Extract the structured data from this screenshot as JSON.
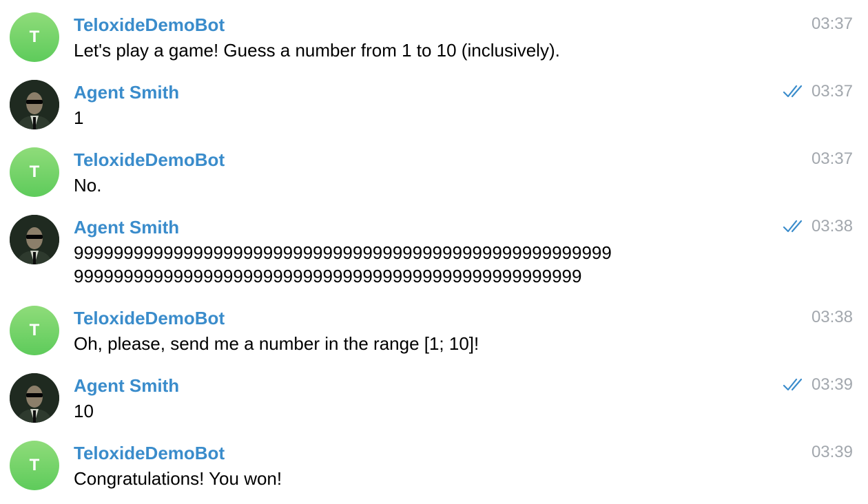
{
  "messages": [
    {
      "sender": "TeloxideDemoBot",
      "avatar_letter": "T",
      "lines": [
        "Let's play a game! Guess a number from 1 to 10 (inclusively)."
      ],
      "time": "03:37",
      "read": false
    },
    {
      "sender": "Agent Smith",
      "lines": [
        "1"
      ],
      "time": "03:37",
      "read": true
    },
    {
      "sender": "TeloxideDemoBot",
      "avatar_letter": "T",
      "lines": [
        "No."
      ],
      "time": "03:37",
      "read": false
    },
    {
      "sender": "Agent Smith",
      "lines": [
        "999999999999999999999999999999999999999999999999999999",
        "999999999999999999999999999999999999999999999999999"
      ],
      "time": "03:38",
      "read": true
    },
    {
      "sender": "TeloxideDemoBot",
      "avatar_letter": "T",
      "lines": [
        "Oh, please, send me a number in the range [1; 10]!"
      ],
      "time": "03:38",
      "read": false
    },
    {
      "sender": "Agent Smith",
      "lines": [
        "10"
      ],
      "time": "03:39",
      "read": true
    },
    {
      "sender": "TeloxideDemoBot",
      "avatar_letter": "T",
      "lines": [
        "Congratulations! You won!"
      ],
      "time": "03:39",
      "read": false
    }
  ],
  "colors": {
    "sender_name": "#3a8ccb",
    "time": "#a2a7ad",
    "read_check": "#3a8ccb",
    "bot_avatar": "#6fd26a"
  },
  "icons": {
    "read_status": "double-check-icon",
    "user_avatar": "agent-smith-portrait"
  }
}
